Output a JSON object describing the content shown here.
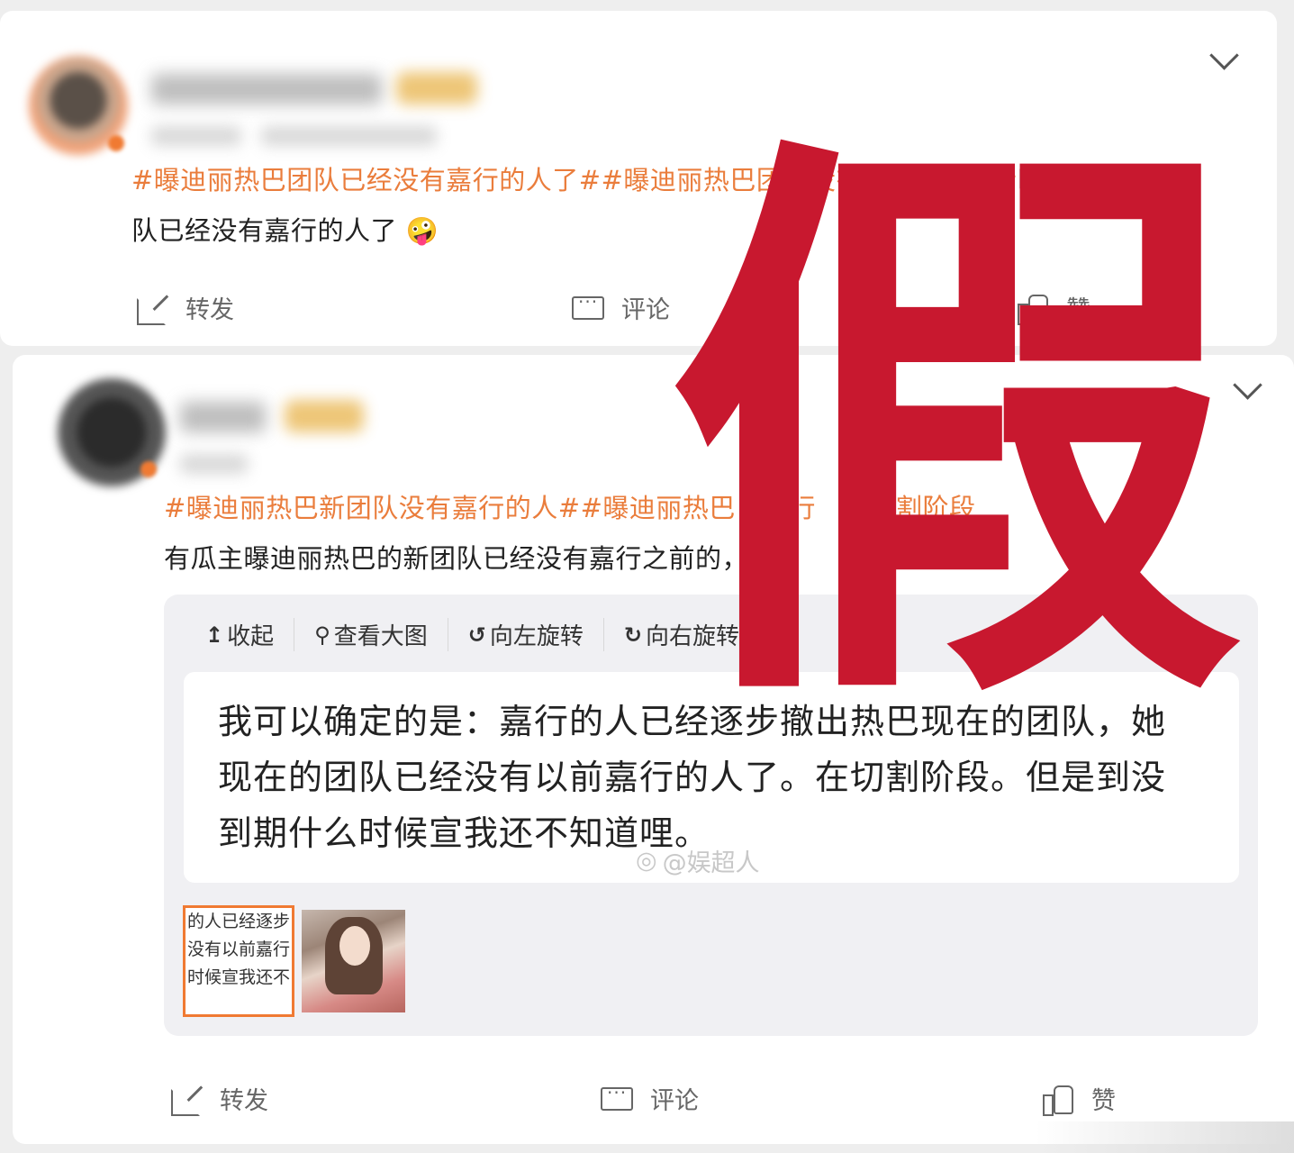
{
  "overlay": {
    "label": "假",
    "color": "#c8182f"
  },
  "post1": {
    "tags": [
      "#曝迪丽热巴团队已经没有嘉行的人了#",
      "#曝迪丽热巴团队没有嘉行的人了#"
    ],
    "text_line1_rest": "曝迪丽热巴团",
    "text_line2": "队已经没有嘉行的人了",
    "emoji": "🤪",
    "actions": {
      "share": "转发",
      "comment": "评论",
      "like": "赞"
    }
  },
  "post2": {
    "tags": [
      "#曝迪丽热巴新团队没有嘉行的人#",
      "#曝迪丽热巴",
      "嘉行",
      "在切割阶段"
    ],
    "text": "有瓜主曝迪丽热巴的新团队已经没有嘉行之前的",
    "text_tail": "，在",
    "toolbar": {
      "collapse": "收起",
      "view_large": "查看大图",
      "rotate_left": "向左旋转",
      "rotate_right": "向右旋转"
    },
    "quote": "我可以确定的是：嘉行的人已经逐步撤出热巴现在的团队，她现在的团队已经没有以前嘉行的人了。在切割阶段。但是到没到期什么时候宣我还不知道哩。",
    "watermark": "@娱超人",
    "thumb_lines": [
      "的人已经逐步",
      "没有以前嘉行",
      "时候宣我还不"
    ],
    "actions": {
      "share": "转发",
      "comment": "评论",
      "like": "赞"
    }
  },
  "colors": {
    "tag": "#ea7d3c",
    "thumb_border": "#f07a32"
  }
}
